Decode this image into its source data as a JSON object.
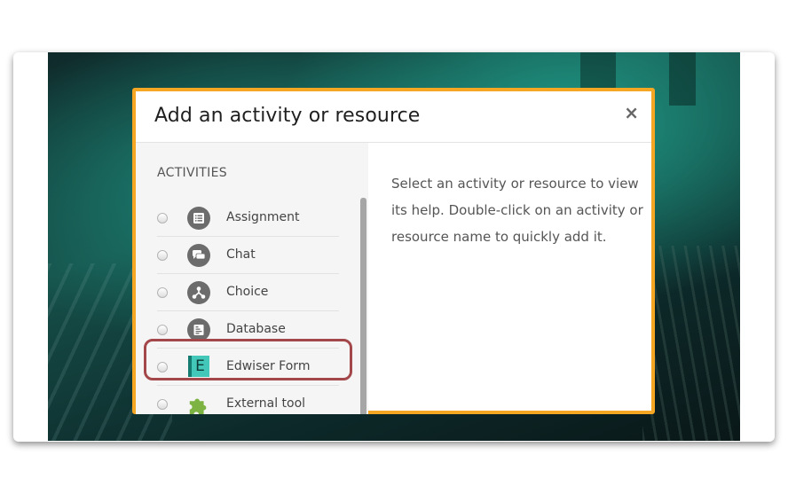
{
  "modal": {
    "title": "Add an activity or resource",
    "close_label": "×",
    "section_label": "ACTIVITIES",
    "help_text": "Select an activity or resource to view its help. Double-click on an activity or resource name to quickly add it."
  },
  "activities": [
    {
      "label": "Assignment",
      "icon": "assignment-icon",
      "selected": false
    },
    {
      "label": "Chat",
      "icon": "chat-icon",
      "selected": false
    },
    {
      "label": "Choice",
      "icon": "choice-icon",
      "selected": false
    },
    {
      "label": "Database",
      "icon": "database-icon",
      "selected": false
    },
    {
      "label": "Edwiser Form",
      "icon": "edwiser-form-icon",
      "icon_letter": "E",
      "selected": false,
      "highlighted": true
    },
    {
      "label": "External tool",
      "icon": "puzzle-icon",
      "selected": false
    }
  ],
  "colors": {
    "modal_border": "#f5a623",
    "highlight": "#a3474a",
    "edwiser_icon": "#43c7b8",
    "puzzle_icon": "#7cb342"
  }
}
